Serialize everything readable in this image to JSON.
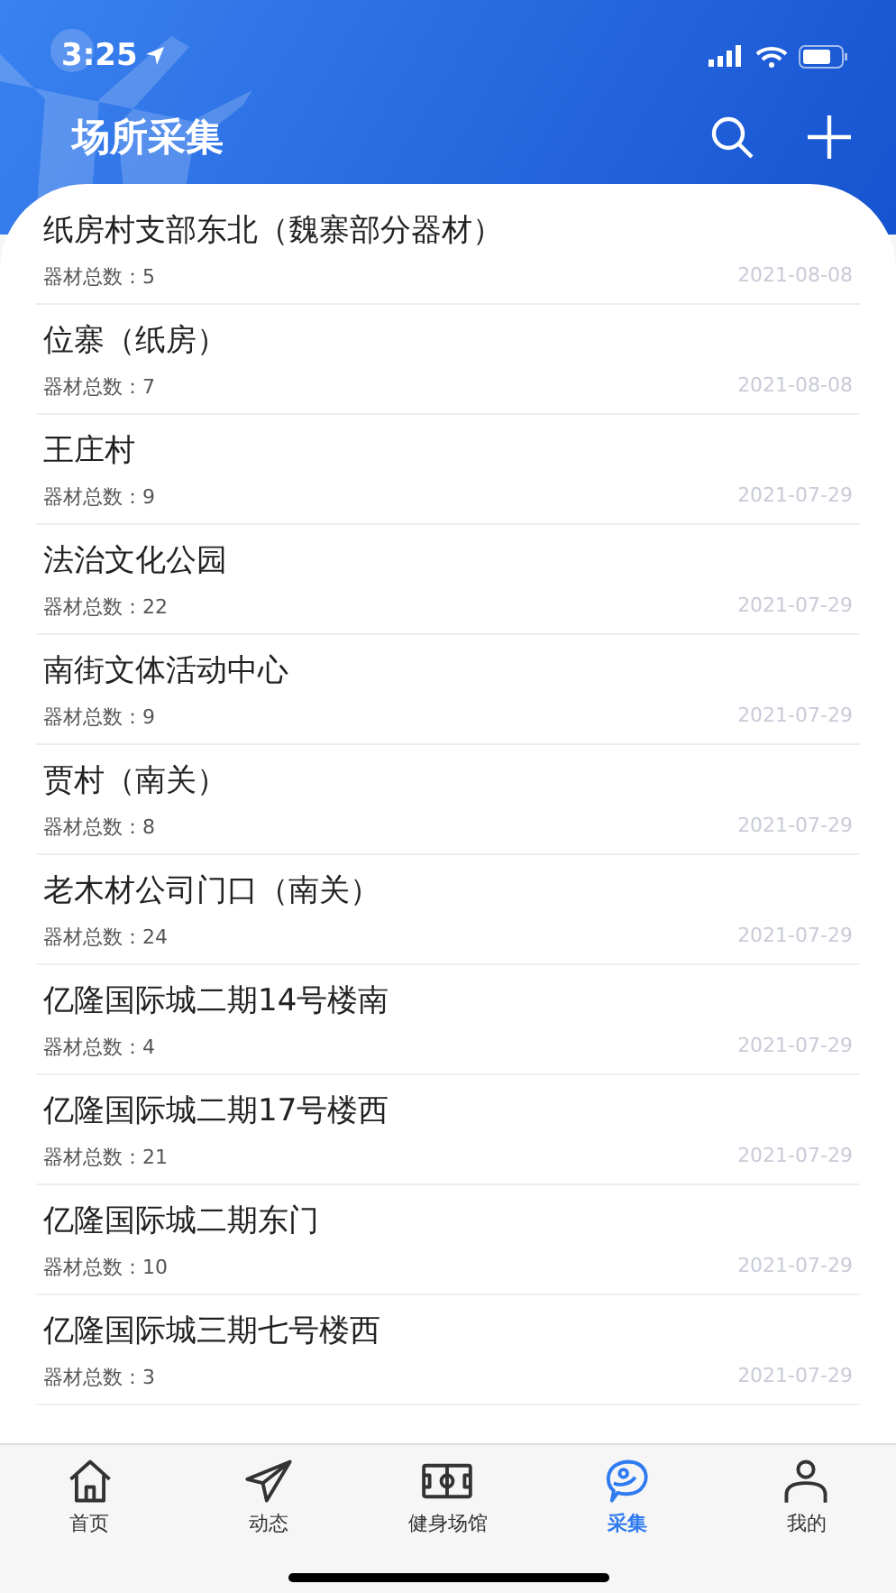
{
  "status_bar": {
    "time": "3:25"
  },
  "header": {
    "title": "场所采集"
  },
  "items": [
    {
      "name": "纸房村支部东北（魏寨部分器材）",
      "count": "器材总数：5",
      "date": "2021-08-08"
    },
    {
      "name": "位寨（纸房）",
      "count": "器材总数：7",
      "date": "2021-08-08"
    },
    {
      "name": "王庄村",
      "count": "器材总数：9",
      "date": "2021-07-29"
    },
    {
      "name": "法治文化公园",
      "count": "器材总数：22",
      "date": "2021-07-29"
    },
    {
      "name": "南街文体活动中心",
      "count": "器材总数：9",
      "date": "2021-07-29"
    },
    {
      "name": "贾村（南关）",
      "count": "器材总数：8",
      "date": "2021-07-29"
    },
    {
      "name": "老木材公司门口（南关）",
      "count": "器材总数：24",
      "date": "2021-07-29"
    },
    {
      "name": "亿隆国际城二期14号楼南",
      "count": "器材总数：4",
      "date": "2021-07-29"
    },
    {
      "name": "亿隆国际城二期17号楼西",
      "count": "器材总数：21",
      "date": "2021-07-29"
    },
    {
      "name": "亿隆国际城二期东门",
      "count": "器材总数：10",
      "date": "2021-07-29"
    },
    {
      "name": "亿隆国际城三期七号楼西",
      "count": "器材总数：3",
      "date": "2021-07-29"
    }
  ],
  "tabs": [
    {
      "label": "首页",
      "kind": "home",
      "selected": false
    },
    {
      "label": "动态",
      "kind": "plane",
      "selected": false
    },
    {
      "label": "健身场馆",
      "kind": "field",
      "selected": false
    },
    {
      "label": "采集",
      "kind": "chat",
      "selected": true
    },
    {
      "label": "我的",
      "kind": "person",
      "selected": false
    }
  ]
}
